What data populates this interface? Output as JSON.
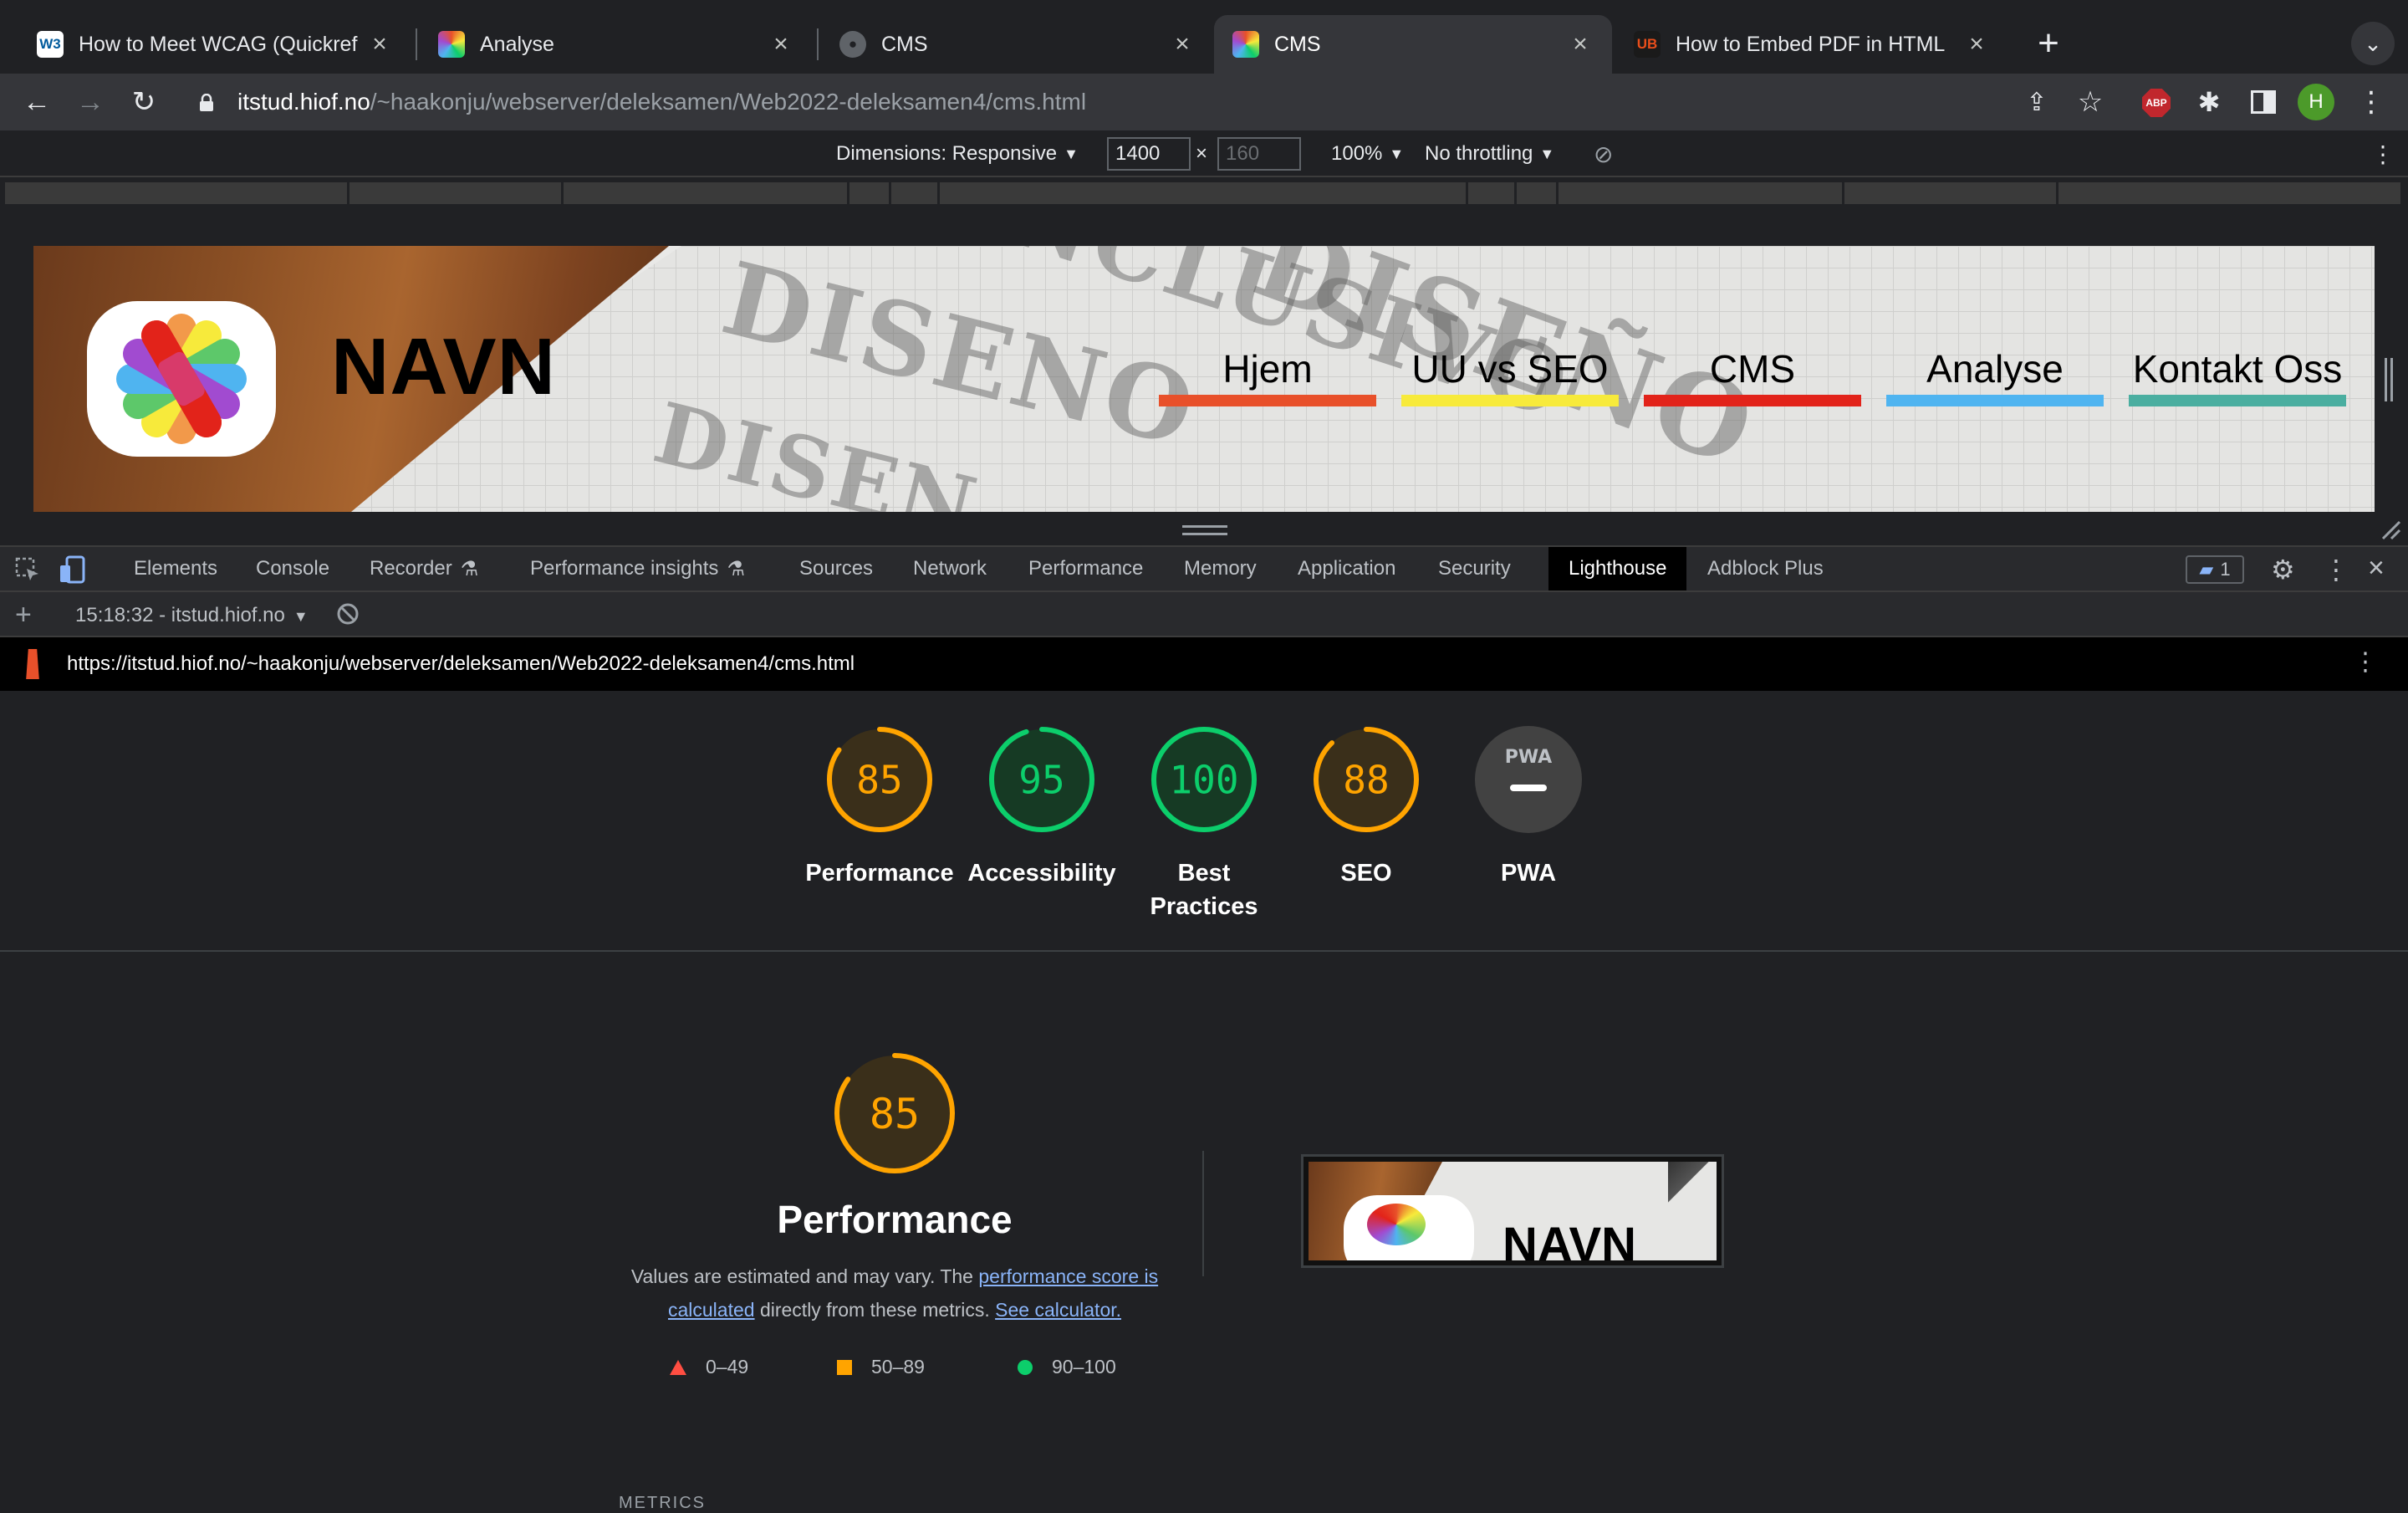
{
  "tabs": [
    {
      "label": "How to Meet WCAG (Quickref R",
      "favicon": "W3",
      "favicon_color": "#005a9c",
      "active": false
    },
    {
      "label": "Analyse",
      "favicon": "",
      "favicon_color": "#ffffff",
      "active": false
    },
    {
      "label": "CMS",
      "favicon": "globe-icon",
      "favicon_color": "#5f6368",
      "active": false
    },
    {
      "label": "CMS",
      "favicon": "",
      "favicon_color": "#ffffff",
      "active": true
    },
    {
      "label": "How to Embed PDF in HTML",
      "favicon": "UB",
      "favicon_color": "#e94e1b",
      "active": false
    }
  ],
  "address_bar": {
    "host": "itstud.hiof.no",
    "path": "/~haakonju/webserver/deleksamen/Web2022-deleksamen4/cms.html"
  },
  "toolbar_icons": {
    "profile_initial": "H",
    "abp_label": "ABP"
  },
  "device_toolbar": {
    "dimensions_label": "Dimensions: Responsive",
    "width": "1400",
    "times": "×",
    "height_placeholder": "160",
    "zoom": "100%",
    "throttling": "No throttling"
  },
  "site": {
    "title": "NAVN",
    "nav": [
      {
        "label": "Hjem",
        "color": "#e8502a"
      },
      {
        "label": "UU vs SEO",
        "color": "#f7ea3b"
      },
      {
        "label": "CMS",
        "color": "#e2231a"
      },
      {
        "label": "Analyse",
        "color": "#4fb4f0"
      },
      {
        "label": "Kontakt Oss",
        "color": "#4aaea0"
      }
    ]
  },
  "devtools": {
    "tabs": [
      "Elements",
      "Console",
      "Recorder",
      "Performance insights",
      "Sources",
      "Network",
      "Performance",
      "Memory",
      "Application",
      "Security",
      "Lighthouse",
      "Adblock Plus"
    ],
    "active_tab": "Lighthouse",
    "issues_count": "1",
    "report_selector": "15:18:32 - itstud.hiof.no",
    "report_url": "https://itstud.hiof.no/~haakonju/webserver/deleksamen/Web2022-deleksamen4/cms.html"
  },
  "lighthouse": {
    "scores": [
      {
        "label": "Performance",
        "value": 85,
        "color": "#ffa400",
        "track": "#3a2f1a"
      },
      {
        "label": "Accessibility",
        "value": 95,
        "color": "#0cce6b",
        "track": "#163a24"
      },
      {
        "label": "Best Practices",
        "value": 100,
        "color": "#0cce6b",
        "track": "#163a24"
      },
      {
        "label": "SEO",
        "value": 88,
        "color": "#ffa400",
        "track": "#3a2f1a"
      },
      {
        "label": "PWA",
        "value": null,
        "color": "#e8eaed",
        "track": "#424242"
      }
    ],
    "pwa_badge_text": "PWA",
    "performance": {
      "title": "Performance",
      "score": 85,
      "desc_before": "Values are estimated and may vary. The ",
      "desc_link1": "performance score is calculated",
      "desc_middle": " directly from these metrics. ",
      "desc_link2": "See calculator."
    },
    "legend": [
      {
        "range": "0–49",
        "shape": "triangle",
        "color": "#ff4e42"
      },
      {
        "range": "50–89",
        "shape": "square",
        "color": "#ffa400"
      },
      {
        "range": "90–100",
        "shape": "circle",
        "color": "#0cce6b"
      }
    ],
    "thumbnail_title": "NAVN",
    "metrics_heading": "METRICS"
  }
}
